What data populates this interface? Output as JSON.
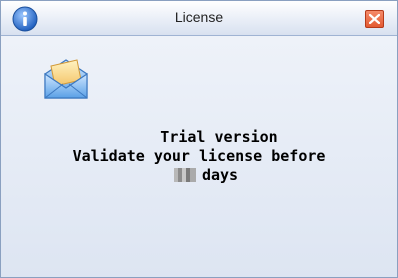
{
  "window": {
    "title": "License"
  },
  "icons": {
    "title_icon": "info-icon",
    "close_icon": "close-icon",
    "content_icon": "envelope-icon"
  },
  "message": {
    "line1": "Trial version",
    "line2": "Validate your license before",
    "line3_suffix": "days"
  },
  "colors": {
    "close_button": "#e35a32",
    "info_icon": "#2f6fc8"
  }
}
